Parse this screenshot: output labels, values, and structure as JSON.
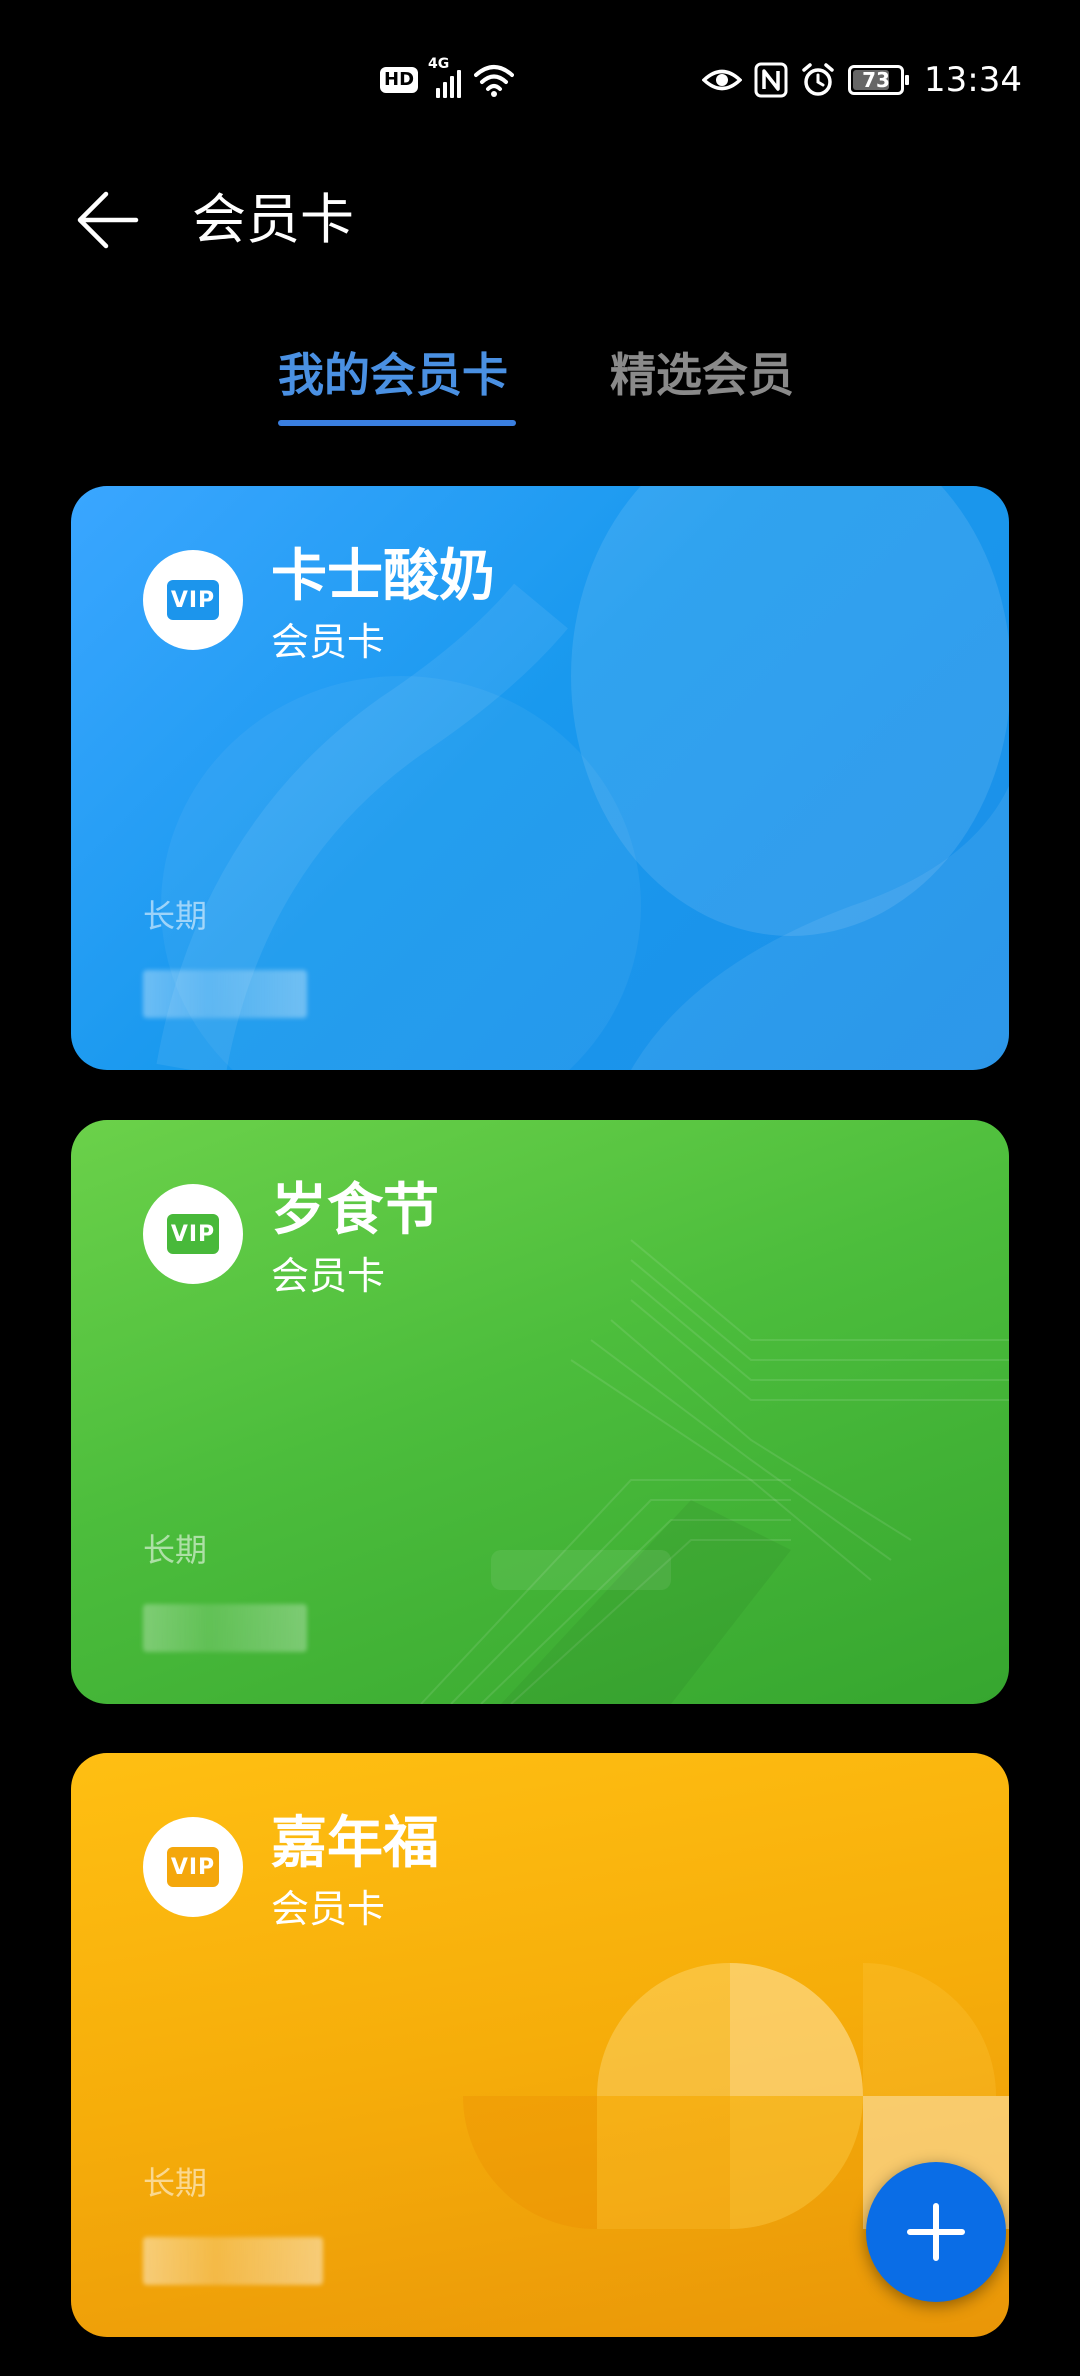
{
  "status_bar": {
    "hd_badge": "HD",
    "network_type": "4G",
    "battery_level": "73",
    "time": "13:34",
    "icons": [
      "hd-icon",
      "signal-icon",
      "wifi-icon",
      "eye-icon",
      "nfc-icon",
      "alarm-icon",
      "battery-icon"
    ]
  },
  "header": {
    "title": "会员卡",
    "back_icon": "arrow-left-icon"
  },
  "tabs": [
    {
      "label": "我的会员卡",
      "active": true
    },
    {
      "label": "精选会员",
      "active": false
    }
  ],
  "cards": [
    {
      "name": "卡士酸奶",
      "type": "会员卡",
      "validity": "长期",
      "vip_label": "VIP",
      "color": "#1999ee"
    },
    {
      "name": "岁食节",
      "type": "会员卡",
      "validity": "长期",
      "vip_label": "VIP",
      "color": "#4cbd3c"
    },
    {
      "name": "嘉年福",
      "type": "会员卡",
      "validity": "长期",
      "vip_label": "VIP",
      "color": "#f6ad0a"
    }
  ],
  "fab": {
    "icon": "plus-icon",
    "color": "#0a6de6"
  }
}
